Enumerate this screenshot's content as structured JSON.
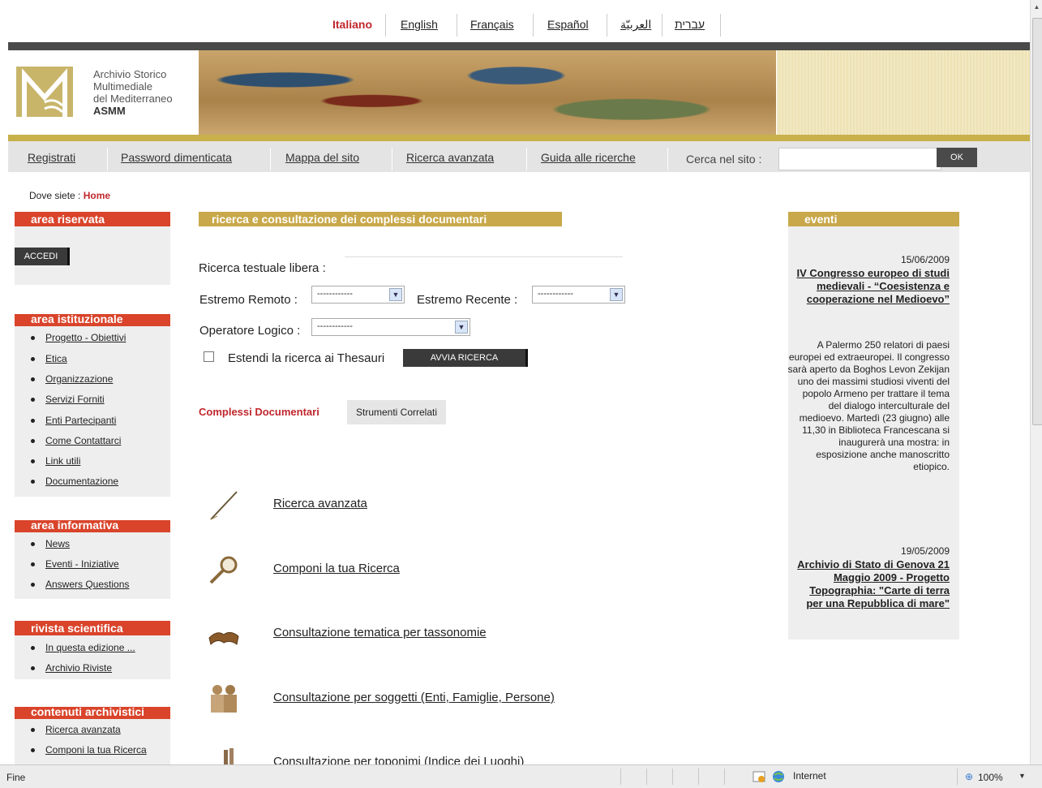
{
  "languages": [
    {
      "label": "Italiano",
      "active": true
    },
    {
      "label": "English"
    },
    {
      "label": "Français"
    },
    {
      "label": "Español"
    },
    {
      "label": "العربيّة"
    },
    {
      "label": "עברית"
    }
  ],
  "logo": {
    "line1": "Archivio Storico",
    "line2": "Multimediale",
    "line3": "del Mediterraneo",
    "abbr": "ASMM"
  },
  "nav": {
    "items": [
      "Registrati",
      "Password dimenticata",
      "Mappa del sito",
      "Ricerca avanzata",
      "Guida alle ricerche"
    ],
    "search_label": "Cerca nel sito :",
    "search_value": "",
    "ok_label": "OK"
  },
  "breadcrumb": {
    "prefix": "Dove siete : ",
    "home": "Home"
  },
  "left": {
    "reserved": {
      "title": "area riservata",
      "button": "ACCEDI"
    },
    "institutional": {
      "title": "area istituzionale",
      "items": [
        "Progetto - Obiettivi",
        "Etica",
        "Organizzazione",
        "Servizi Forniti",
        "Enti Partecipanti",
        "Come Contattarci",
        "Link utili",
        "Documentazione"
      ]
    },
    "informative": {
      "title": "area informativa",
      "items": [
        "News",
        "Eventi - Iniziative",
        "Answers Questions"
      ]
    },
    "journal": {
      "title": "rivista scientifica",
      "items": [
        "In questa edizione ...",
        "Archivio Riviste"
      ]
    },
    "archive": {
      "title": "contenuti archivistici",
      "items": [
        "Ricerca avanzata",
        "Componi la tua Ricerca"
      ]
    }
  },
  "main": {
    "heading": "ricerca e consultazione dei complessi documentari",
    "free_text_label": "Ricerca testuale libera :",
    "remote_label": "Estremo Remoto :",
    "remote_value": "------------",
    "recent_label": "Estremo Recente :",
    "recent_value": "------------",
    "logic_label": "Operatore Logico :",
    "logic_value": "------------",
    "thesauri_label": "Estendi la ricerca ai Thesauri",
    "search_button": "AVVIA RICERCA",
    "tab_active": "Complessi Documentari",
    "tab_other": "Strumenti Correlati",
    "options": [
      {
        "label": "Ricerca avanzata",
        "icon": "quill-pen-icon"
      },
      {
        "label": "Componi la tua Ricerca",
        "icon": "magnifier-icon"
      },
      {
        "label": "Consultazione tematica per tassonomie",
        "icon": "open-book-icon"
      },
      {
        "label": "Consultazione per soggetti (Enti, Famiglie, Persone)",
        "icon": "people-icon"
      },
      {
        "label": "Consultazione per toponimi (Indice dei Luoghi)",
        "icon": "places-icon"
      }
    ]
  },
  "events": {
    "title": "eventi",
    "items": [
      {
        "date": "15/06/2009",
        "title": "IV Congresso europeo di studi medievali - “Coesistenza e cooperazione nel Medioevo”",
        "body": "A Palermo 250 relatori di paesi europei ed extraeuropei. Il congresso sarà aperto da Boghos Levon Zekijan uno dei massimi studiosi viventi del popolo Armeno per trattare il tema del dialogo interculturale del medioevo. Martedì (23 giugno) alle 11,30 in Biblioteca Francescana si inaugurerà una mostra: in esposizione anche manoscritto etiopico."
      },
      {
        "date": "19/05/2009",
        "title": "Archivio di Stato di Genova 21 Maggio 2009 - Progetto Topographia: \"Carte di terra per una Repubblica di mare\""
      }
    ]
  },
  "statusbar": {
    "text": "Fine",
    "zone": "Internet",
    "zoom": "100%"
  },
  "colors": {
    "accent_red": "#d9442b",
    "accent_gold": "#c8a84a",
    "active_text": "#c0272d"
  }
}
